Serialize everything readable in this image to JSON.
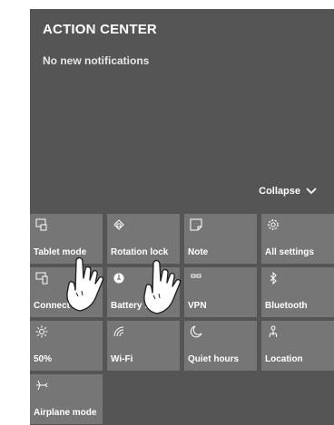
{
  "action_center": {
    "title": "ACTION CENTER",
    "subtitle": "No new notifications",
    "collapse_label": "Collapse"
  },
  "tiles": [
    {
      "label": "Tablet mode",
      "icon": "tablet-mode-icon"
    },
    {
      "label": "Rotation lock",
      "icon": "rotation-lock-icon"
    },
    {
      "label": "Note",
      "icon": "note-icon"
    },
    {
      "label": "All settings",
      "icon": "gear-icon"
    },
    {
      "label": "Connect",
      "icon": "connect-icon"
    },
    {
      "label": "Battery saver",
      "icon": "battery-saver-icon"
    },
    {
      "label": "VPN",
      "icon": "vpn-icon"
    },
    {
      "label": "Bluetooth",
      "icon": "bluetooth-icon"
    },
    {
      "label": "50%",
      "icon": "brightness-icon"
    },
    {
      "label": "Wi-Fi",
      "icon": "wifi-icon"
    },
    {
      "label": "Quiet hours",
      "icon": "moon-icon"
    },
    {
      "label": "Location",
      "icon": "location-icon"
    },
    {
      "label": "Airplane mode",
      "icon": "airplane-icon"
    }
  ],
  "colors": {
    "panel": "#555555",
    "tile": "#767676",
    "text": "#ffffff"
  }
}
